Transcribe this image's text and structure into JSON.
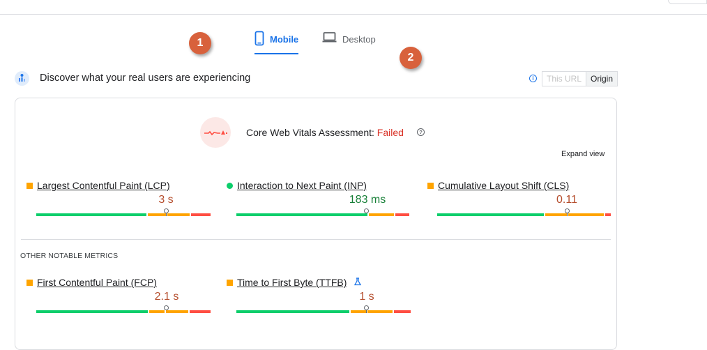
{
  "tabs": [
    {
      "label": "Mobile",
      "icon": "phone-icon",
      "active": true
    },
    {
      "label": "Desktop",
      "icon": "laptop-icon",
      "active": false
    }
  ],
  "badges": [
    "1",
    "2"
  ],
  "header": {
    "title": "Discover what your real users are experiencing"
  },
  "scope_toggle": {
    "options": [
      "This URL",
      "Origin"
    ],
    "selected": "Origin"
  },
  "assessment": {
    "label": "Core Web Vitals Assessment:",
    "status": "Failed"
  },
  "expand_label": "Expand view",
  "metrics": [
    {
      "label": "Largest Contentful Paint (LCP)",
      "value": "3 s",
      "rating": "needs-improvement"
    },
    {
      "label": "Interaction to Next Paint (INP)",
      "value": "183 ms",
      "rating": "good"
    },
    {
      "label": "Cumulative Layout Shift (CLS)",
      "value": "0.11",
      "rating": "needs-improvement"
    }
  ],
  "other_heading": "OTHER NOTABLE METRICS",
  "other_metrics": [
    {
      "label": "First Contentful Paint (FCP)",
      "value": "2.1 s",
      "rating": "needs-improvement"
    },
    {
      "label": "Time to First Byte (TTFB)",
      "value": "1 s",
      "rating": "needs-improvement",
      "experimental_icon": "flask-icon"
    }
  ],
  "colors": {
    "accent": "#1a73e8",
    "good": "#0cce6b",
    "needs_improvement": "#ffa400",
    "poor": "#ff4e42",
    "failed": "#d93025"
  }
}
